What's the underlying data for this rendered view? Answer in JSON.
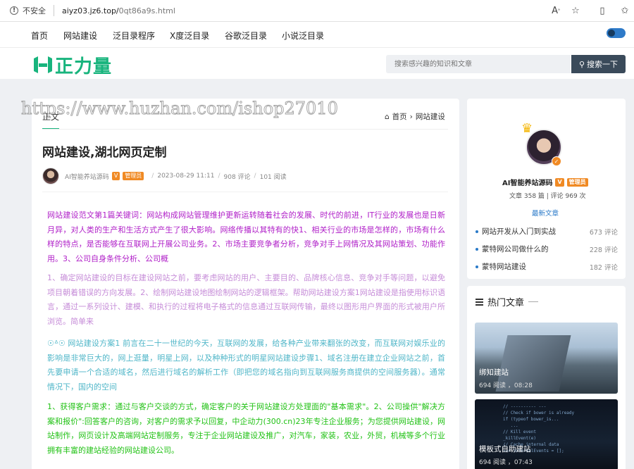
{
  "browser": {
    "security_label": "不安全",
    "url_host": "aiyz03.jz6.top/",
    "url_path": "0qt86a9s.html"
  },
  "nav": {
    "items": [
      "首页",
      "网站建设",
      "泛目录程序",
      "X度泛目录",
      "谷歌泛目录",
      "小说泛目录"
    ]
  },
  "header": {
    "logo_text": "正力量",
    "search_placeholder": "搜索感兴趣的知识和文章",
    "search_button": "搜索一下"
  },
  "watermark": "https://www.huzhan.com/ishop27010",
  "article": {
    "tab": "正文",
    "breadcrumb": [
      "首页",
      "网站建设"
    ],
    "title": "网站建设,湖北网页定制",
    "author": "AI智能养站源码",
    "v_badge": "V",
    "admin_badge": "管理员",
    "date": "2023-08-29 11:11",
    "comments": "908 评论",
    "reads": "101 阅读",
    "paragraphs": [
      "网站建设范文第1篇关键词：网站构成网站管理维护更新运转随着社会的发展、时代的前进，IT行业的发展也是日新月异，对人类的生产和生活方式产生了很大影响。网络传播以其特有的快1、相关行业的市场是怎样的，市场有什么样的特点，是否能够在互联网上开展公司业务。2、市场主要竞争者分析，竞争对手上网情况及其网站策划、功能作用。3、公司自身条件分析、公司概",
      "1、确定网站建设的目标在建设网站之前，要考虑网站的用户、主要目的、品牌核心信息、竞争对手等问题，以避免项目朝着错误的方向发展。2、绘制网站建设地图绘制网站的逻辑框架。帮助网站建设方案1网站建设是指使用标识语言，通过一系列设计、建模、和执行的过程将电子格式的信息通过互联网传输，最终以图形用户界面的形式被用户所浏览。简单来",
      "☉ᐞ☉ 网站建设方案1 前言在二十一世纪的今天，互联网的发展，给各种产业带来翻张的改变，而互联网对娱乐业的影响是非常巨大的，网上逛量，明星上网，以及种种形式的明星网站建设步骤1、域名注册在建立企业网站之前，首先要申请一个合适的域名，然后进行域名的解析工作（即把您的域名指向到互联网服务商提供的空间服务器）。通常情况下，国内的空间",
      "1、获得客户需求：通过与客户交谈的方式，确定客户的关于网站建设方处理面的\"基本需求\"。2、公司操供\"解决方案和报价\":回答客户的咨询，对客户的需求予以回复，中企动力(300.cn)23年专注企业服务；为您提供网站建设，网站制作，网页设计及高端网站定制服务，专注于企业网站建设及推广，对汽车，家装，农业，外贸，机械等多个行业拥有丰富的建站经验的网站建设公司。"
    ]
  },
  "profile": {
    "name": "AI智能养站源码",
    "v_badge": "V",
    "admin_badge": "管理员",
    "stats": "文章 358 篇 | 评论 969 次",
    "latest_label": "最新文章",
    "latest": [
      {
        "title": "网站开发从入门到实战",
        "count": "673 评论"
      },
      {
        "title": "蒙特网公司做什么的",
        "count": "228 评论"
      },
      {
        "title": "蒙特网站建设",
        "count": "182 评论"
      }
    ]
  },
  "hot": {
    "title": "热门文章",
    "items": [
      {
        "title": "绑知建站",
        "meta": "694 阅读 ，08:28"
      },
      {
        "title": "模板式自助建站",
        "meta": "694 阅读 ，07:43"
      }
    ]
  },
  "colors": {
    "brand": "#18b47d",
    "p1": "#b020c8",
    "p2": "#c68cd8",
    "p3": "#4fb6c8",
    "p4": "#22c216",
    "link": "#2a7ac8"
  }
}
